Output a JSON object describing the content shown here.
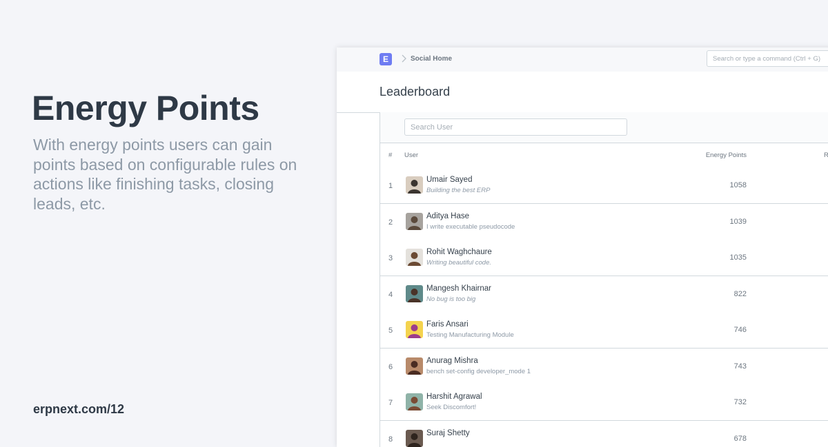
{
  "hero": {
    "title": "Energy Points",
    "description": "With energy points users can gain points based on configurable rules on actions like finishing tasks, closing leads, etc.",
    "link": "erpnext.com/12"
  },
  "navbar": {
    "logo_letter": "E",
    "breadcrumb": "Social Home",
    "search_placeholder": "Search or type a command (Ctrl + G)"
  },
  "page": {
    "title": "Leaderboard"
  },
  "filter": {
    "search_placeholder": "Search User"
  },
  "table": {
    "headers": {
      "num": "#",
      "user": "User",
      "points": "Energy Points",
      "rank": "R"
    },
    "rows": [
      {
        "rank": "1",
        "name": "Umair Sayed",
        "bio": "Building the best ERP",
        "bio_italic": true,
        "points": "1058",
        "avatar_bg": "#d9cdbf",
        "avatar_fg": "#3b3530"
      },
      {
        "rank": "2",
        "name": "Aditya Hase",
        "bio": "I write executable pseudocode",
        "bio_italic": false,
        "points": "1039",
        "avatar_bg": "#a7a39e",
        "avatar_fg": "#5b4a3c"
      },
      {
        "rank": "3",
        "name": "Rohit Waghchaure",
        "bio": "Writing beautiful code.",
        "bio_italic": true,
        "points": "1035",
        "avatar_bg": "#e4e1dc",
        "avatar_fg": "#6b4a33"
      },
      {
        "rank": "4",
        "name": "Mangesh Khairnar",
        "bio": "No bug is too big",
        "bio_italic": true,
        "points": "822",
        "avatar_bg": "#5f8a8a",
        "avatar_fg": "#4a3328"
      },
      {
        "rank": "5",
        "name": "Faris Ansari",
        "bio": "Testing Manufacturing Module",
        "bio_italic": false,
        "points": "746",
        "avatar_bg": "#f4d34e",
        "avatar_fg": "#9c3c8c"
      },
      {
        "rank": "6",
        "name": "Anurag Mishra",
        "bio": "bench set-config developer_mode 1",
        "bio_italic": false,
        "points": "743",
        "avatar_bg": "#b88a6a",
        "avatar_fg": "#4a2c22"
      },
      {
        "rank": "7",
        "name": "Harshit Agrawal",
        "bio": "Seek Discomfort!",
        "bio_italic": false,
        "points": "732",
        "avatar_bg": "#8fb3a8",
        "avatar_fg": "#7a4b34"
      },
      {
        "rank": "8",
        "name": "Suraj Shetty",
        "bio": "",
        "bio_italic": false,
        "points": "678",
        "avatar_bg": "#6a5a50",
        "avatar_fg": "#2e241e"
      }
    ]
  }
}
